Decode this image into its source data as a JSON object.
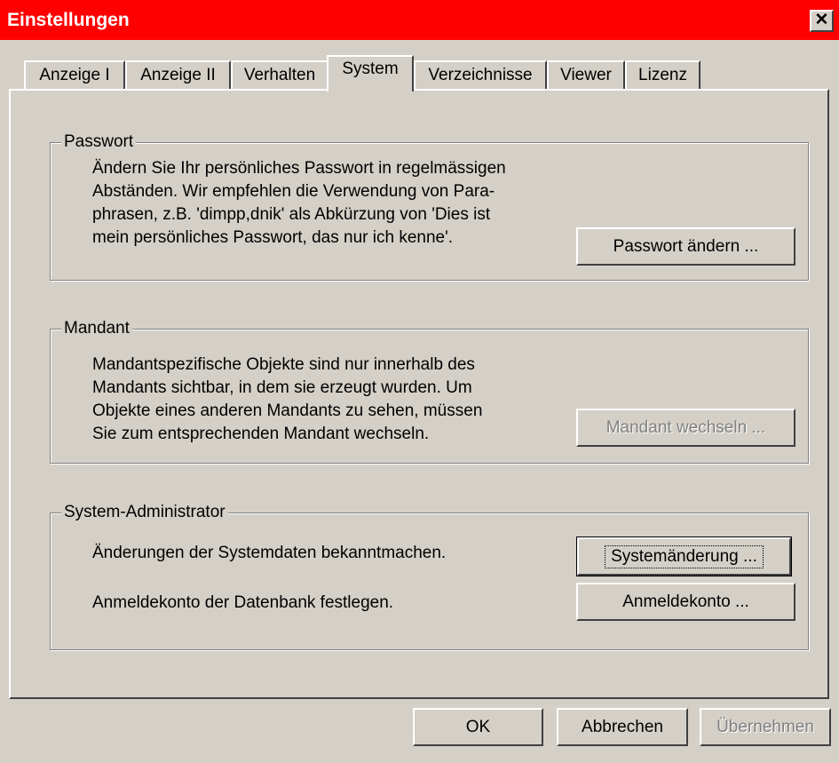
{
  "window": {
    "title": "Einstellungen",
    "close_glyph": "✕"
  },
  "tabs": [
    {
      "label": "Anzeige I"
    },
    {
      "label": "Anzeige II"
    },
    {
      "label": "Verhalten"
    },
    {
      "label": "System",
      "active": true
    },
    {
      "label": "Verzeichnisse"
    },
    {
      "label": "Viewer"
    },
    {
      "label": "Lizenz"
    }
  ],
  "passwort": {
    "legend": "Passwort",
    "lines": [
      "Ändern Sie Ihr persönliches Passwort in regelmässigen",
      "Abständen. Wir empfehlen die Verwendung von Para-",
      "phrasen, z.B. 'dimpp,dnik' als Abkürzung von 'Dies ist",
      "mein persönliches Passwort, das nur ich kenne'."
    ],
    "button": "Passwort ändern ..."
  },
  "mandant": {
    "legend": "Mandant",
    "lines": [
      "Mandantspezifische Objekte sind nur innerhalb des",
      "Mandants sichtbar, in dem sie erzeugt wurden. Um",
      "Objekte eines anderen Mandants zu sehen, müssen",
      "Sie zum entsprechenden Mandant wechseln."
    ],
    "button": "Mandant wechseln ...",
    "button_disabled": true
  },
  "sysadmin": {
    "legend": "System-Administrator",
    "line1": "Änderungen der Systemdaten bekanntmachen.",
    "button1": "Systemänderung ...",
    "line2": "Anmeldekonto der Datenbank festlegen.",
    "button2": "Anmeldekonto ..."
  },
  "footer": {
    "ok": "OK",
    "cancel": "Abbrechen",
    "apply": "Übernehmen",
    "apply_disabled": true
  },
  "colors": {
    "titlebar": "#ff0000",
    "face": "#d4d0c8",
    "disabled_text": "#808080"
  }
}
